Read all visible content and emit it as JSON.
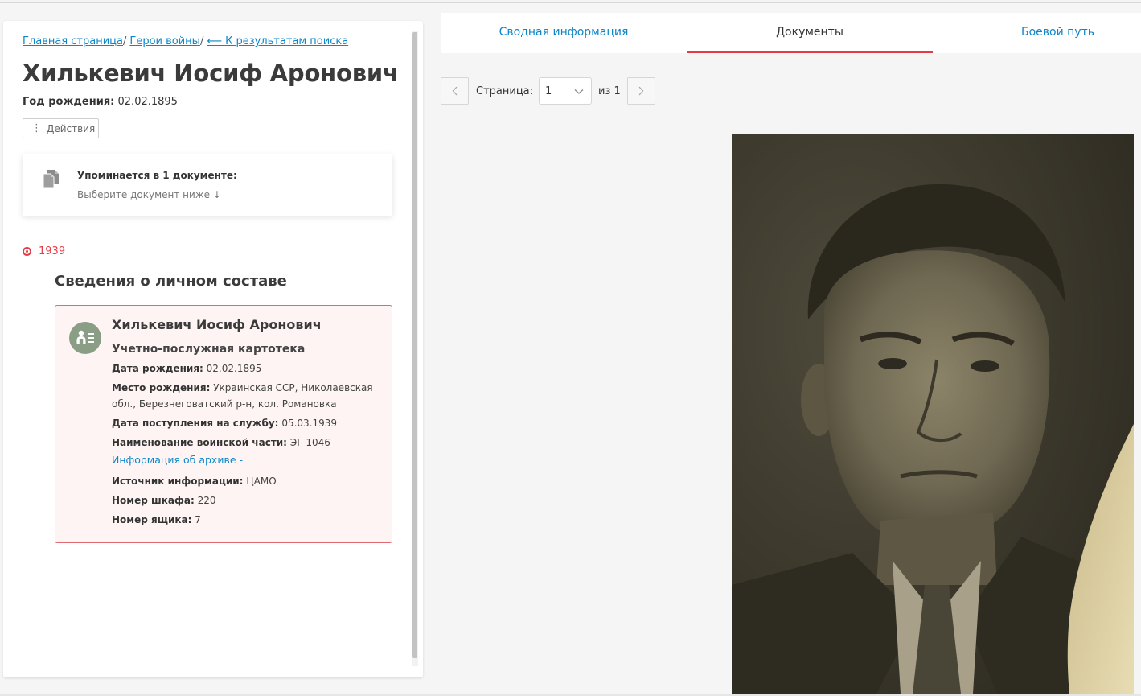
{
  "breadcrumb": {
    "home": "Главная страница",
    "heroes": "Герои войны",
    "back": "⟵ К результатам поиска",
    "sep": "/"
  },
  "person": {
    "name": "Хилькевич Иосиф Аронович",
    "birth_label": "Год рождения:",
    "birth_value": "02.02.1895"
  },
  "actions": {
    "label": "Действия"
  },
  "mention": {
    "title": "Упоминается в 1 документе:",
    "subtitle": "Выберите документ ниже  ↓"
  },
  "timeline": {
    "year": "1939",
    "section_title": "Сведения о личном составе"
  },
  "record": {
    "name": "Хилькевич Иосиф Аронович",
    "type": "Учетно-послужная картотека",
    "fields": [
      {
        "label": "Дата рождения:",
        "value": "02.02.1895"
      },
      {
        "label": "Место рождения:",
        "value": "Украинская ССР, Николаевская обл., Березнеговатский р-н, кол. Романовка"
      },
      {
        "label": "Дата поступления на службу:",
        "value": "05.03.1939"
      },
      {
        "label": "Наименование воинской части:",
        "value": "ЭГ 1046"
      }
    ],
    "archive_link": "Информация об архиве -",
    "fields2": [
      {
        "label": "Источник информации:",
        "value": "ЦАМО"
      },
      {
        "label": "Номер шкафа:",
        "value": "220"
      },
      {
        "label": "Номер ящика:",
        "value": "7"
      }
    ]
  },
  "tabs": [
    {
      "label": "Сводная информация",
      "active": false
    },
    {
      "label": "Документы",
      "active": true
    },
    {
      "label": "Боевой путь",
      "active": false
    }
  ],
  "pager": {
    "page_label": "Страница:",
    "page_value": "1",
    "of_text": "из 1"
  },
  "colors": {
    "accent": "#e53b46",
    "link": "#0e86c8",
    "avatar": "#8a9e86"
  }
}
